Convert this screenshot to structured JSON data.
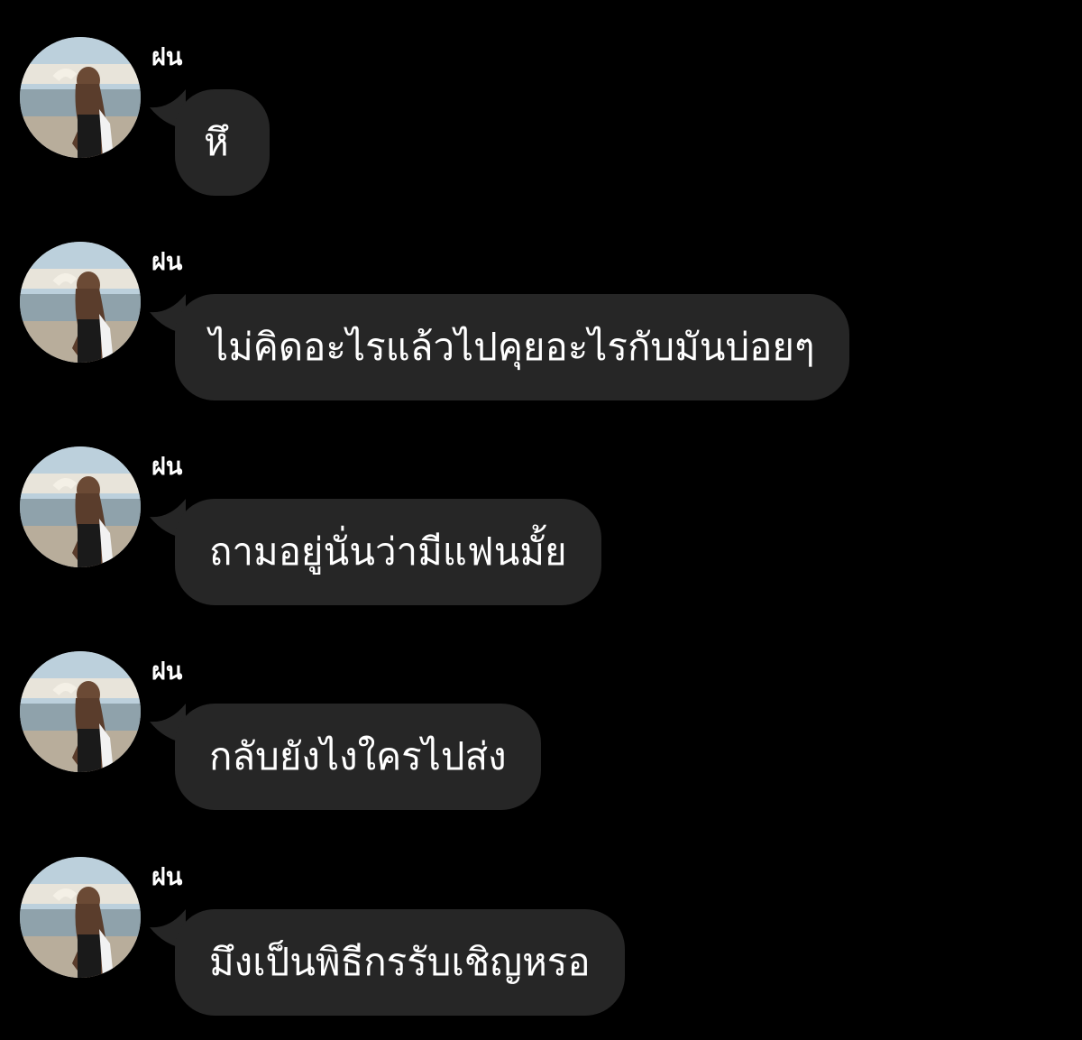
{
  "chat": {
    "messages": [
      {
        "sender": "ฝน",
        "text": "หึ"
      },
      {
        "sender": "ฝน",
        "text": "ไม่คิดอะไรแล้วไปคุยอะไรกับมันบ่อยๆ"
      },
      {
        "sender": "ฝน",
        "text": "ถามอยู่นั่นว่ามีแฟนมั้ย"
      },
      {
        "sender": "ฝน",
        "text": "กลับยังไงใครไปส่ง"
      },
      {
        "sender": "ฝน",
        "text": "มึงเป็นพิธีกรรับเชิญหรอ"
      }
    ]
  },
  "colors": {
    "background": "#000000",
    "bubble": "#262626",
    "text": "#ffffff"
  },
  "icons": {
    "avatar": "profile-photo-beach-avatar"
  }
}
